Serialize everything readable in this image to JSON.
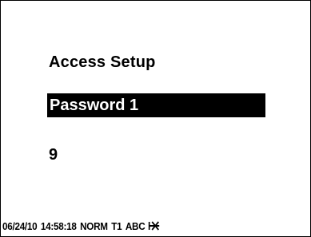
{
  "screen": {
    "title": "Access Setup",
    "selected_item": "Password 1",
    "value": "9"
  },
  "status_bar": {
    "date": "06/24/10",
    "time": "14:58:18",
    "mode": "NORM",
    "tariff": "T1",
    "phases": "ABC",
    "icon": "battery-disconnected-icon"
  },
  "colors": {
    "background": "#ffffff",
    "foreground": "#000000",
    "highlight_bg": "#000000",
    "highlight_fg": "#ffffff"
  }
}
